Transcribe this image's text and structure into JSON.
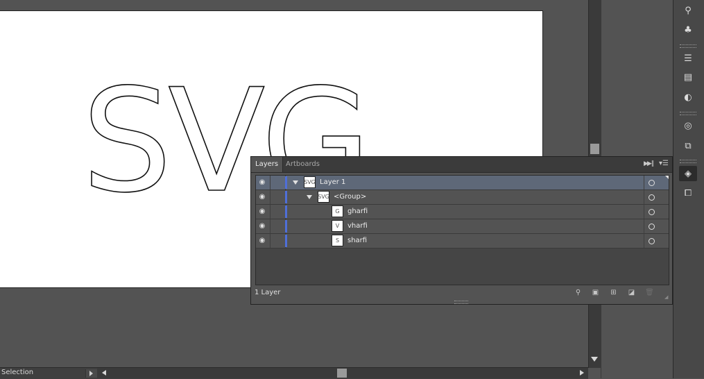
{
  "canvas": {
    "artwork_text": "SVG"
  },
  "layers_panel": {
    "tabs": [
      {
        "label": "Layers"
      },
      {
        "label": "Artboards"
      }
    ],
    "collapse_icon": "double-chevron-right-icon",
    "menu_icon": "panel-menu-icon",
    "rows": [
      {
        "name": "Layer 1",
        "thumb": "SVG",
        "indent": "layer",
        "expanded": true,
        "selected": true
      },
      {
        "name": "<Group>",
        "thumb": "SVG",
        "indent": "group",
        "expanded": true,
        "selected": false
      },
      {
        "name": "gharfi",
        "thumb": "G",
        "indent": "path",
        "expanded": false,
        "selected": false
      },
      {
        "name": "vharfi",
        "thumb": "V",
        "indent": "path",
        "expanded": false,
        "selected": false
      },
      {
        "name": "sharfi",
        "thumb": "S",
        "indent": "path",
        "expanded": false,
        "selected": false
      }
    ],
    "layer_count": "1 Layer",
    "footer_tools": [
      "locate-object-icon",
      "make-clipping-mask-icon",
      "create-sublayer-icon",
      "create-new-layer-icon",
      "delete-icon"
    ]
  },
  "status_bar": {
    "tool_label": "Selection"
  },
  "dock": {
    "buttons": [
      "symbol-sprayer-icon",
      "club-icon",
      "stroke-icon",
      "gradient-icon",
      "transparency-icon",
      "appearance-icon",
      "artboards-icon",
      "layers-icon",
      "transform-icon"
    ],
    "active": "layers-icon"
  },
  "colors": {
    "ui_bg": "#535353",
    "selection_row": "#5e6878",
    "layer_color": "#4f6fd8"
  }
}
